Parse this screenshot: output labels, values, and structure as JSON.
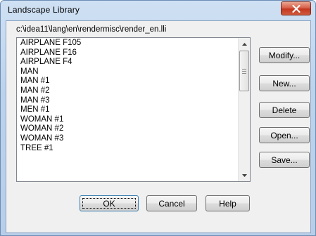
{
  "window": {
    "title": "Landscape Library",
    "close_glyph": "X"
  },
  "path": "c:\\idea11\\lang\\en\\rendermisc\\render_en.lli",
  "list": {
    "items": [
      "AIRPLANE F105",
      "AIRPLANE F16",
      "AIRPLANE F4",
      "MAN",
      "MAN #1",
      "MAN #2",
      "MAN #3",
      "MEN #1",
      "WOMAN #1",
      "WOMAN #2",
      "WOMAN #3",
      "TREE #1"
    ]
  },
  "buttons": {
    "modify": "Modify...",
    "new": "New...",
    "delete": "Delete",
    "open": "Open...",
    "save": "Save...",
    "ok": "OK",
    "cancel": "Cancel",
    "help": "Help"
  },
  "colors": {
    "close_button": "#c3381f",
    "frame": "#bcd2ec",
    "client": "#f0f0f0"
  }
}
